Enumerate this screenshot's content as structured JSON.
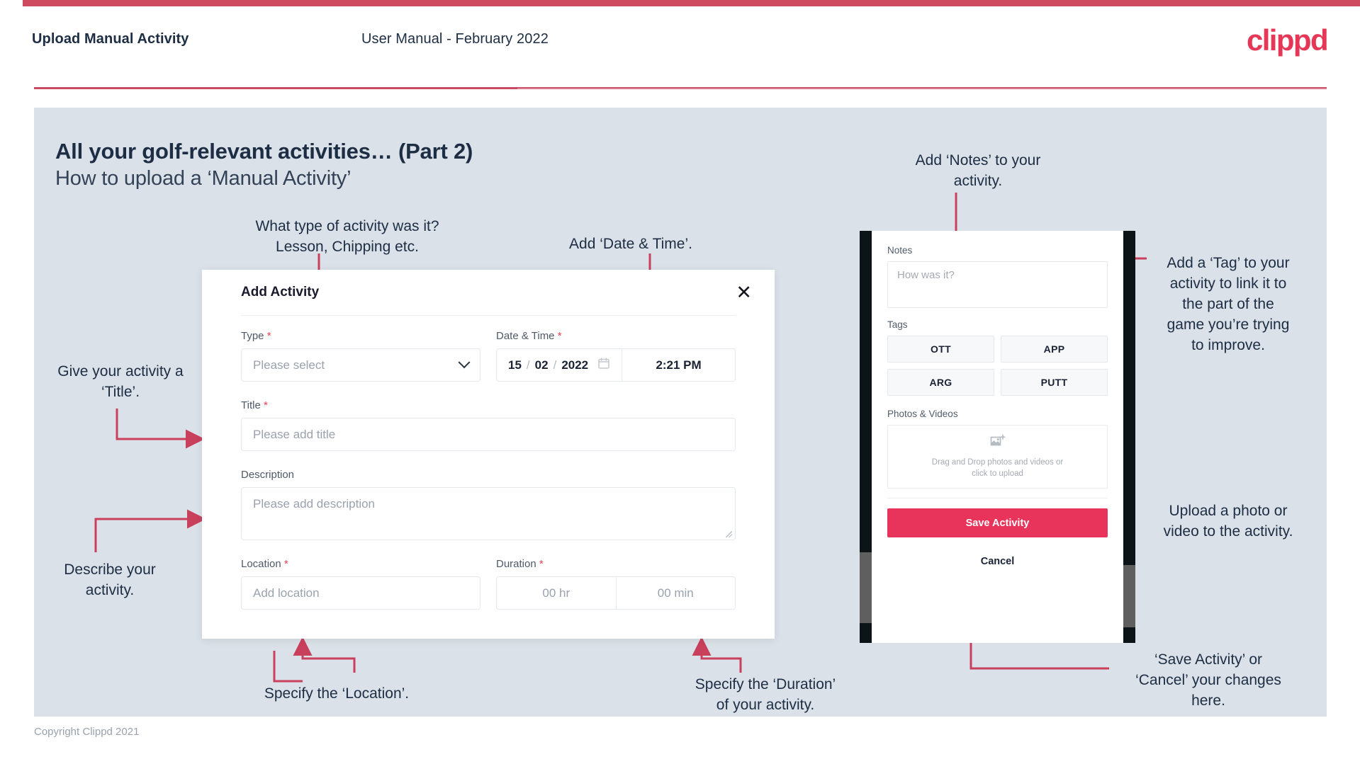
{
  "header": {
    "title": "Upload Manual Activity",
    "subtitle": "User Manual - February 2022",
    "logo": "clippd"
  },
  "slide": {
    "heading": "All your golf-relevant activities… (Part 2)",
    "subheading": "How to upload a ‘Manual Activity’"
  },
  "modal": {
    "title": "Add Activity",
    "close_icon": "close-icon",
    "fields": {
      "type": {
        "label": "Type",
        "required": "*",
        "placeholder": "Please select",
        "chevron_icon": "chevron-down-icon"
      },
      "datetime": {
        "label": "Date & Time",
        "required": "*",
        "day": "15",
        "sep1": "/",
        "month": "02",
        "sep2": "/",
        "year": "2022",
        "calendar_icon": "calendar-icon",
        "time": "2:21 PM"
      },
      "title": {
        "label": "Title",
        "required": "*",
        "placeholder": "Please add title"
      },
      "description": {
        "label": "Description",
        "placeholder": "Please add description"
      },
      "location": {
        "label": "Location",
        "required": "*",
        "placeholder": "Add location"
      },
      "duration": {
        "label": "Duration",
        "required": "*",
        "hours": "00 hr",
        "minutes": "00 min"
      }
    }
  },
  "phone": {
    "notes": {
      "label": "Notes",
      "placeholder": "How was it?"
    },
    "tags": {
      "label": "Tags",
      "items": [
        "OTT",
        "APP",
        "ARG",
        "PUTT"
      ]
    },
    "photos": {
      "label": "Photos & Videos",
      "icon": "add-image-icon",
      "drop_line1": "Drag and Drop photos and videos or",
      "drop_line2": "click to upload"
    },
    "save_label": "Save Activity",
    "cancel_label": "Cancel"
  },
  "annotations": {
    "type": "What type of activity was it?\nLesson, Chipping etc.",
    "datetime": "Add ‘Date & Time’.",
    "title": "Give your activity a\n‘Title’.",
    "description": "Describe your\nactivity.",
    "location": "Specify the ‘Location’.",
    "duration": "Specify the ‘Duration’\nof your activity.",
    "notes": "Add ‘Notes’ to your\nactivity.",
    "tags": "Add a ‘Tag’ to your\nactivity to link it to\nthe part of the\ngame you’re trying\nto improve.",
    "upload": "Upload a photo or\nvideo to the activity.",
    "save": "‘Save Activity’ or\n‘Cancel’ your changes\nhere."
  },
  "footer": {
    "copyright": "Copyright Clippd 2021"
  },
  "colors": {
    "brand_red": "#e63757",
    "bar_red": "#cd4a5f",
    "arrow_red": "#c9405c",
    "slide_bg": "#dbe1e8",
    "ink": "#1d2d44"
  }
}
